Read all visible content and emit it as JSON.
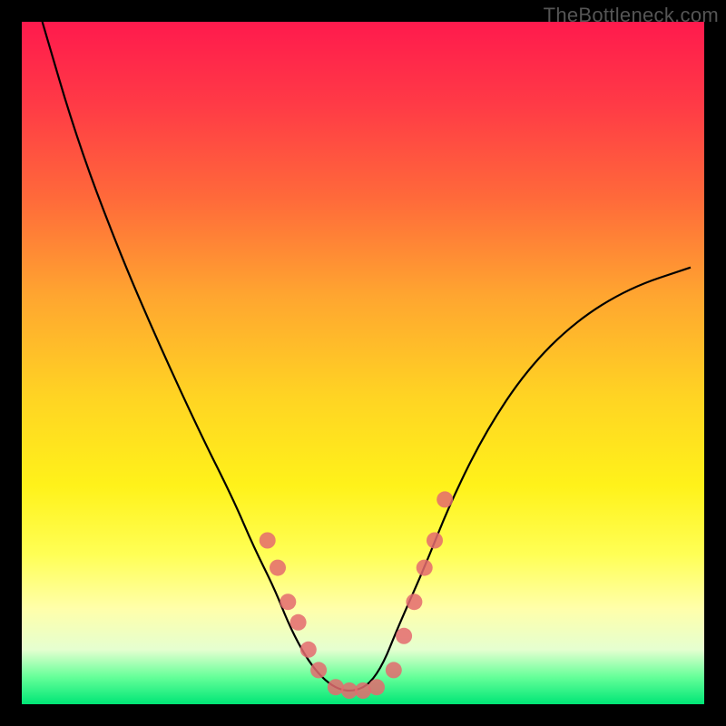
{
  "watermark": "TheBottleneck.com",
  "chart_data": {
    "type": "line",
    "title": "",
    "xlabel": "",
    "ylabel": "",
    "xlim": [
      0,
      100
    ],
    "ylim": [
      0,
      100
    ],
    "series": [
      {
        "name": "bottleneck-curve",
        "x": [
          3,
          8,
          14,
          20,
          26,
          31,
          34,
          37,
          39,
          41,
          43,
          45,
          47,
          49,
          51,
          53,
          55,
          59,
          63,
          68,
          74,
          81,
          89,
          98
        ],
        "y": [
          100,
          83,
          67,
          53,
          40,
          30,
          23,
          17,
          12,
          8,
          5,
          3,
          2,
          2,
          3,
          6,
          11,
          20,
          30,
          40,
          49,
          56,
          61,
          64
        ]
      }
    ],
    "markers": {
      "name": "highlight-dots",
      "points": [
        {
          "x": 36,
          "y": 24
        },
        {
          "x": 37.5,
          "y": 20
        },
        {
          "x": 39,
          "y": 15
        },
        {
          "x": 40.5,
          "y": 12
        },
        {
          "x": 42,
          "y": 8
        },
        {
          "x": 43.5,
          "y": 5
        },
        {
          "x": 46,
          "y": 2.5
        },
        {
          "x": 48,
          "y": 2
        },
        {
          "x": 50,
          "y": 2
        },
        {
          "x": 52,
          "y": 2.5
        },
        {
          "x": 54.5,
          "y": 5
        },
        {
          "x": 56,
          "y": 10
        },
        {
          "x": 57.5,
          "y": 15
        },
        {
          "x": 59,
          "y": 20
        },
        {
          "x": 60.5,
          "y": 24
        },
        {
          "x": 62,
          "y": 30
        }
      ]
    },
    "colors": {
      "curve": "#000000",
      "marker": "#e46a6f",
      "gradient_top": "#ff1a4d",
      "gradient_bottom": "#00e676"
    }
  }
}
